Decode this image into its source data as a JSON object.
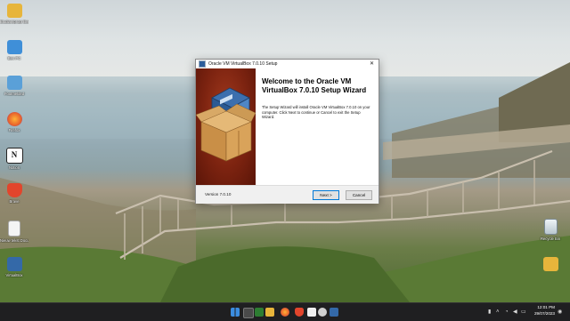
{
  "desktop": {
    "icons_left": [
      {
        "label": "Etudiantprogr Bedeas",
        "icon": "folder-icon",
        "color": "#e7b53b"
      },
      {
        "label": "Ben PC",
        "icon": "this-pc-icon",
        "color": "#3f8fd8"
      },
      {
        "label": "Foutmelded",
        "icon": "shortcut-icon",
        "color": "#5aa0d8"
      },
      {
        "label": "Firefox",
        "icon": "firefox-icon",
        "color": "#e8632b"
      },
      {
        "label": "Notion",
        "icon": "notion-icon",
        "color": "#ffffff"
      },
      {
        "label": "Brave",
        "icon": "brave-icon",
        "color": "#e2452c"
      },
      {
        "label": "Nieuw tekst Document",
        "icon": "text-document-icon",
        "color": "#f4f4f4"
      },
      {
        "label": "VirtualBox",
        "icon": "virtualbox-icon",
        "color": "#3469a8"
      }
    ],
    "icons_right": [
      {
        "label": "Recycle Bin",
        "icon": "recycle-bin-icon",
        "color": "#dfe7ec"
      },
      {
        "label": "",
        "icon": "folder-icon",
        "color": "#e7b53b"
      }
    ]
  },
  "dialog": {
    "title": "Oracle VM VirtualBox 7.0.10 Setup",
    "close_glyph": "✕",
    "heading": "Welcome to the Oracle VM VirtualBox 7.0.10 Setup Wizard",
    "description": "The Setup Wizard will install Oracle VM VirtualBox 7.0.10 on your computer. Click Next to continue or Cancel to exit the Setup Wizard.",
    "version": "Version 7.0.10",
    "next_label": "Next >",
    "cancel_label": "Cancel"
  },
  "taskbar": {
    "apps": [
      {
        "name": "start-button",
        "color": "#3b8de0"
      },
      {
        "name": "taskbar-file-explorer",
        "color": "#4a4a4a"
      },
      {
        "name": "taskbar-terminal",
        "color": "#2d7d32"
      },
      {
        "name": "taskbar-folder",
        "color": "#e7b53b"
      },
      {
        "name": "taskbar-firefox",
        "color": "#e8632b"
      },
      {
        "name": "taskbar-brave",
        "color": "#e2452c"
      },
      {
        "name": "taskbar-notion",
        "color": "#f0f0f0"
      },
      {
        "name": "taskbar-github",
        "color": "#d0d0d0"
      },
      {
        "name": "taskbar-virtualbox",
        "color": "#3469a8"
      }
    ],
    "time": "12:01 PM",
    "date": "29/07/2023"
  }
}
